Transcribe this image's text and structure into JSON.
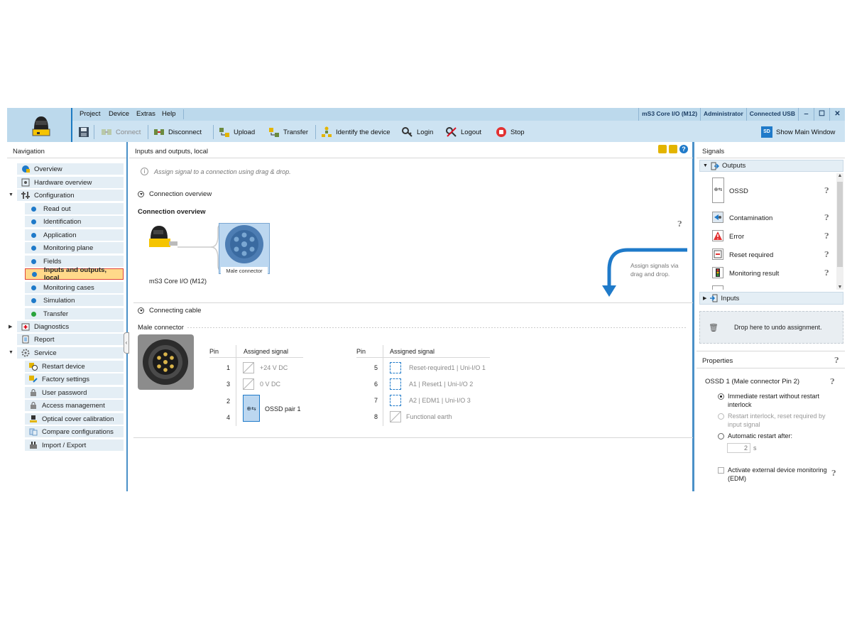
{
  "menu": [
    "Project",
    "Device",
    "Extras",
    "Help"
  ],
  "status": {
    "device": "mS3 Core I/O (M12)",
    "user": "Administrator",
    "connection": "Connected USB"
  },
  "window_buttons": [
    "‒",
    "☐",
    "✕"
  ],
  "toolbar": {
    "connect": "Connect",
    "disconnect": "Disconnect",
    "upload": "Upload",
    "transfer": "Transfer",
    "identify": "Identify the device",
    "login": "Login",
    "logout": "Logout",
    "stop": "Stop",
    "show_main_window": "Show Main Window",
    "show_main_window_icon_text": "SD"
  },
  "navigation": {
    "title": "Navigation",
    "items": [
      {
        "label": "Overview"
      },
      {
        "label": "Hardware overview"
      },
      {
        "label": "Configuration"
      },
      {
        "label": "Read out"
      },
      {
        "label": "Identification"
      },
      {
        "label": "Application"
      },
      {
        "label": "Monitoring plane"
      },
      {
        "label": "Fields"
      },
      {
        "label": "Inputs and outputs, local"
      },
      {
        "label": "Monitoring cases"
      },
      {
        "label": "Simulation"
      },
      {
        "label": "Transfer"
      },
      {
        "label": "Diagnostics"
      },
      {
        "label": "Report"
      },
      {
        "label": "Service"
      },
      {
        "label": "Restart device"
      },
      {
        "label": "Factory settings"
      },
      {
        "label": "User password"
      },
      {
        "label": "Access management"
      },
      {
        "label": "Optical cover calibration"
      },
      {
        "label": "Compare configurations"
      },
      {
        "label": "Import / Export"
      }
    ]
  },
  "center": {
    "title": "Inputs and outputs, local",
    "hint": "Assign signal to a connection using drag & drop.",
    "connection_overview_header": "Connection overview",
    "connection_overview_title": "Connection overview",
    "device_label": "mS3 Core I/O (M12)",
    "connector_label": "Male connector",
    "drag_hint": "Assign signals via drag and drop.",
    "connecting_cable_header": "Connecting cable",
    "male_connector_header": "Male connector",
    "pin_header": "Pin",
    "assigned_signal_header": "Assigned signal",
    "left_pins": [
      {
        "pin": "1",
        "signal": "+24 V DC"
      },
      {
        "pin": "3",
        "signal": "0 V DC"
      },
      {
        "pin": "2",
        "signal": "OSSD pair 1"
      },
      {
        "pin": "4",
        "signal": ""
      }
    ],
    "right_pins": [
      {
        "pin": "5",
        "signal": "Reset-required1 | Uni-I/O 1"
      },
      {
        "pin": "6",
        "signal": "A1 | Reset1 | Uni-I/O 2"
      },
      {
        "pin": "7",
        "signal": "A2 | EDM1 | Uni-I/O 3"
      },
      {
        "pin": "8",
        "signal": "Functional earth"
      }
    ]
  },
  "signals": {
    "title": "Signals",
    "outputs_label": "Outputs",
    "inputs_label": "Inputs",
    "items": [
      {
        "label": "OSSD"
      },
      {
        "label": "Contamination"
      },
      {
        "label": "Error"
      },
      {
        "label": "Reset required"
      },
      {
        "label": "Monitoring result"
      }
    ],
    "drop_hint": "Drop here to undo assignment."
  },
  "properties": {
    "title": "Properties",
    "subtitle": "OSSD 1 (Male connector Pin 2)",
    "option1": "Immediate restart without restart interlock",
    "option2": "Restart interlock, reset required by input signal",
    "option3": "Automatic restart after:",
    "restart_value": "2",
    "restart_unit": "s",
    "edm": "Activate external device monitoring (EDM)"
  },
  "colors": {
    "accent": "#1d7bc2",
    "header_bg": "#bcd9ec",
    "selected_bg": "#ffd98a",
    "selected_border": "#e0453a"
  }
}
